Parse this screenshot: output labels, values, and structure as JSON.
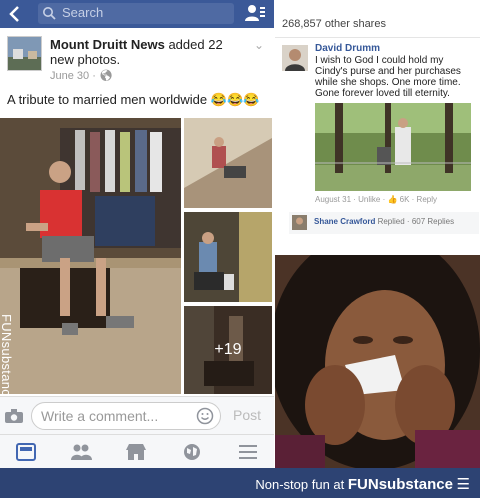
{
  "left_post": {
    "search_placeholder": "Search",
    "page_name": "Mount Druitt News",
    "action_text": "added 22 new photos.",
    "timestamp": "June 30",
    "post_text": "A tribute to married men worldwide 😂😂😂",
    "extra_photos": "+19",
    "watermark": "FUNsubstance",
    "comment_placeholder": "Write a comment...",
    "post_button": "Post"
  },
  "right_post": {
    "shares": "268,857 other shares",
    "comment_author": "David Drumm",
    "comment_text": "I wish to God I could hold my Cindy's purse and her purchases while she shops.  One more time.  Gone forever loved till eternity.",
    "comment_meta": "August 31 · Unlike · 👍 6K · Reply",
    "reply_author": "Shane Crawford",
    "reply_text": "Replied · 607 Replies"
  },
  "footer": {
    "prefix": "Non-stop fun at",
    "brand": "FUNsubstance",
    "logo": "☰"
  },
  "colors": {
    "facebook_blue": "#3b5998",
    "footer_blue": "#2d4373"
  },
  "icons": [
    "back-arrow-icon",
    "search-icon",
    "friend-requests-icon",
    "camera-icon",
    "smiley-icon",
    "news-feed-icon",
    "friends-icon",
    "marketplace-icon",
    "globe-icon",
    "menu-icon"
  ]
}
